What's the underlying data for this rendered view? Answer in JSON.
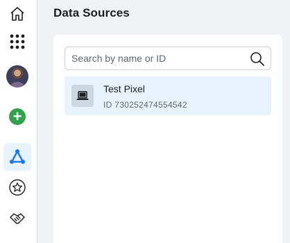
{
  "page": {
    "title": "Data Sources"
  },
  "nav": {
    "items": [
      {
        "id": "home",
        "icon": "home-icon"
      },
      {
        "id": "all-tools",
        "icon": "grid-icon"
      },
      {
        "id": "account",
        "icon": "avatar"
      },
      {
        "id": "create",
        "icon": "add-icon"
      },
      {
        "id": "events-manager",
        "icon": "events-manager-icon",
        "active": true
      },
      {
        "id": "favorites",
        "icon": "star-icon"
      },
      {
        "id": "partners",
        "icon": "handshake-icon"
      }
    ]
  },
  "search": {
    "placeholder": "Search by name or ID",
    "value": ""
  },
  "sources": [
    {
      "name": "Test Pixel",
      "id_text": "ID 730252474554542",
      "icon": "laptop-icon",
      "selected": true
    }
  ],
  "colors": {
    "accent": "#1877f2",
    "add": "#31a24c",
    "selected_row": "#e7f3ff",
    "page_bg": "#f0f2f5"
  }
}
